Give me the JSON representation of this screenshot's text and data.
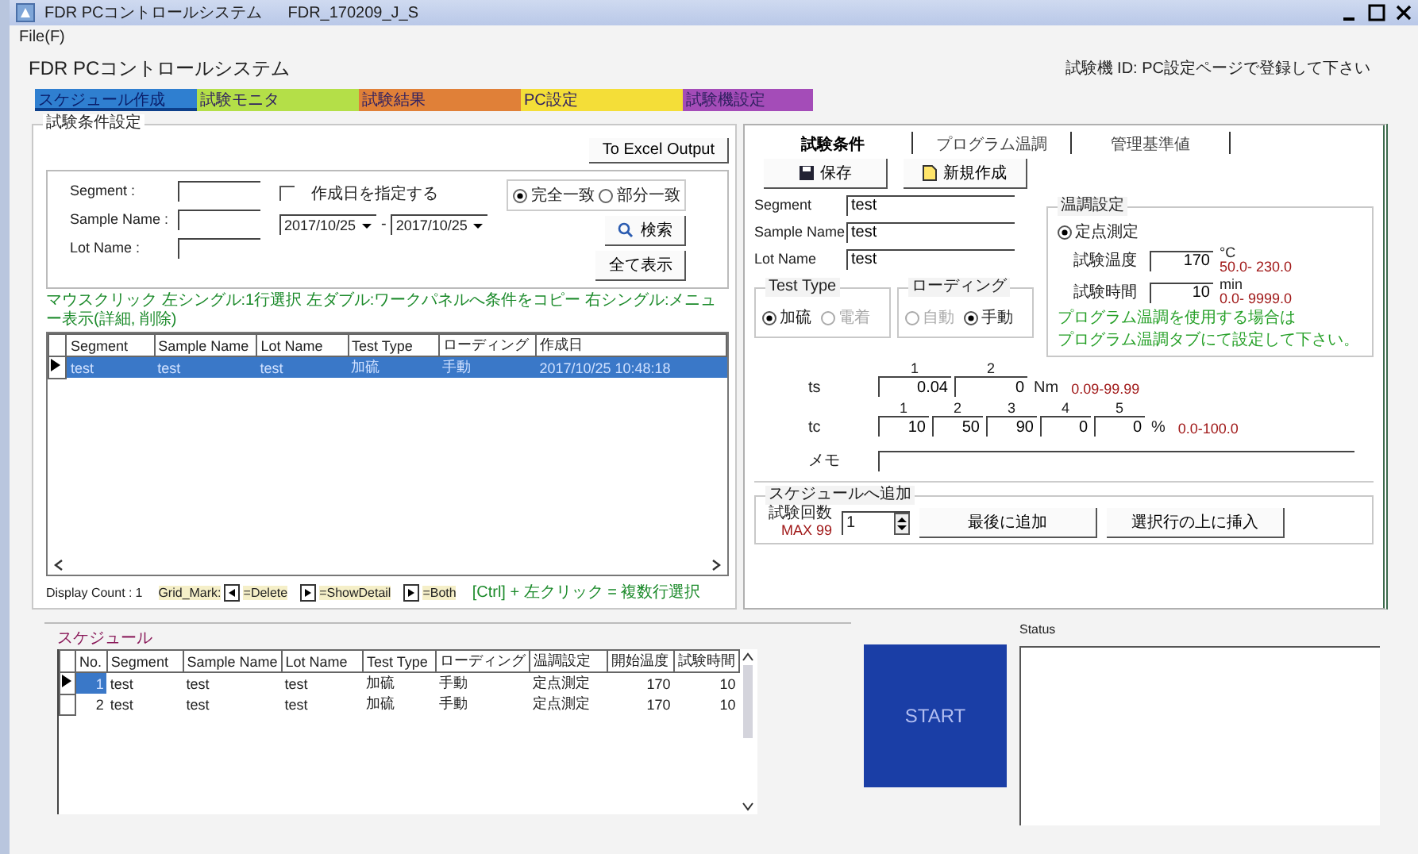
{
  "window": {
    "title": "FDR PCコントロールシステム",
    "subtitle": "FDR_170209_J_S"
  },
  "menu": [
    "File(F)"
  ],
  "app_title": "FDR PCコントロールシステム",
  "machine_id": "試験機 ID: PC設定ページで登録して下さい",
  "tabs": [
    {
      "label": "スケジュール作成",
      "selected": true,
      "color": "#2f7fd0"
    },
    {
      "label": "試験モニタ",
      "selected": false,
      "color": "#b4df48"
    },
    {
      "label": "試験結果",
      "selected": false,
      "color": "#e08038"
    },
    {
      "label": "PC設定",
      "selected": false,
      "color": "#f4de38"
    },
    {
      "label": "試験機設定",
      "selected": false,
      "color": "#a44cb8"
    }
  ],
  "search": {
    "title": "試験条件設定",
    "excel_button": "To Excel Output",
    "fields": [
      {
        "label": "Segment :"
      },
      {
        "label": "Sample Name :"
      },
      {
        "label": "Lot Name :"
      }
    ],
    "date_filter": {
      "label": "作成日を指定する",
      "checked": false,
      "from": "2017/10/25",
      "separator": "-",
      "to": "2017/10/25"
    },
    "match": [
      {
        "label": "完全一致",
        "selected": true
      },
      {
        "label": "部分一致",
        "selected": false
      }
    ],
    "search_button": "検索",
    "show_all_button": "全て表示"
  },
  "hint": "マウスクリック 左シングル:1行選択 左ダブル:ワークパネルへ条件をコピー 右シングル:メニュー表示(詳細, 削除)",
  "results": {
    "columns": [
      "Segment",
      "Sample Name",
      "Lot Name",
      "Test Type",
      "ローディング",
      "作成日"
    ],
    "rows": [
      {
        "cells": [
          "test",
          "test",
          "test",
          "加硫",
          "手動",
          "2017/10/25 10:48:18"
        ],
        "selected": true
      }
    ]
  },
  "display_count": {
    "label": "Display Count :",
    "value": "1"
  },
  "legend": {
    "label": "Grid_Mark:",
    "items": [
      {
        "kind": "left",
        "label": "=Delete"
      },
      {
        "kind": "right",
        "label": "=ShowDetail"
      },
      {
        "kind": "right",
        "label": "=Both"
      }
    ],
    "multi_select": "[Ctrl] + 左クリック = 複数行選択"
  },
  "work": {
    "tabs": [
      {
        "label": "試験条件",
        "selected": true
      },
      {
        "label": "プログラム温調",
        "selected": false
      },
      {
        "label": "管理基準値",
        "selected": false
      }
    ],
    "save_button": "保存",
    "new_button": "新規作成",
    "fields": [
      {
        "label": "Segment",
        "value": "test"
      },
      {
        "label": "Sample Name",
        "value": "test"
      },
      {
        "label": "Lot Name",
        "value": "test"
      }
    ],
    "temp": {
      "title": "温調設定",
      "mode": {
        "label": "定点測定",
        "selected": true
      },
      "temperature": {
        "label": "試験温度",
        "value": "170",
        "unit": "°C",
        "range": "50.0- 230.0"
      },
      "time": {
        "label": "試験時間",
        "value": "10",
        "unit": "min",
        "range": "0.0- 9999.0"
      },
      "note_lines": [
        "プログラム温調を使用する場合は",
        "プログラム温調タブにて設定して下さい。"
      ]
    },
    "test_type": {
      "title": "Test Type",
      "options": [
        {
          "label": "加硫",
          "selected": true,
          "disabled": false
        },
        {
          "label": "電着",
          "selected": false,
          "disabled": true
        }
      ]
    },
    "loading": {
      "title": "ローディング",
      "options": [
        {
          "label": "自動",
          "selected": false,
          "disabled": true
        },
        {
          "label": "手動",
          "selected": true,
          "disabled": false
        }
      ]
    },
    "ts": {
      "label": "ts",
      "indices": [
        "1",
        "2"
      ],
      "values": [
        "0.04",
        "0"
      ],
      "unit": "Nm",
      "range": "0.09-99.99"
    },
    "tc": {
      "label": "tc",
      "indices": [
        "1",
        "2",
        "3",
        "4",
        "5"
      ],
      "values": [
        "10",
        "50",
        "90",
        "0",
        "0"
      ],
      "unit": "%",
      "range": "0.0-100.0"
    },
    "memo": {
      "label": "メモ"
    },
    "add": {
      "title": "スケジュールへ追加",
      "count_label": "試験回数",
      "max": "MAX 99",
      "count": "1",
      "append_button": "最後に追加",
      "insert_button": "選択行の上に挿入"
    }
  },
  "schedule": {
    "title": "スケジュール",
    "columns": [
      "No.",
      "Segment",
      "Sample Name",
      "Lot Name",
      "Test Type",
      "ローディング",
      "温調設定",
      "開始温度",
      "試験時間"
    ],
    "rows": [
      {
        "cells": [
          "1",
          "test",
          "test",
          "test",
          "加硫",
          "手動",
          "定点測定",
          "170",
          "10"
        ],
        "selected": true
      },
      {
        "cells": [
          "2",
          "test",
          "test",
          "test",
          "加硫",
          "手動",
          "定点測定",
          "170",
          "10"
        ],
        "selected": false
      }
    ]
  },
  "start_button": "START",
  "status": {
    "label": "Status"
  }
}
